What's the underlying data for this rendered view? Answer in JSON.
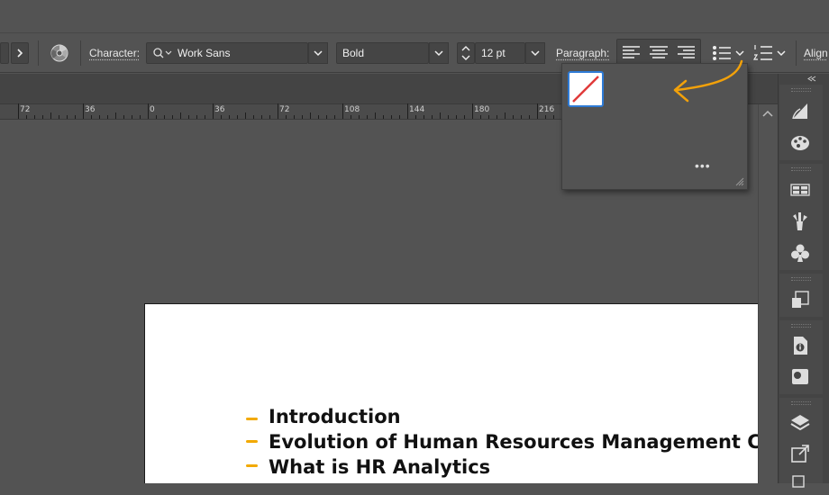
{
  "control_bar": {
    "character_label": "Character:",
    "font_family": "Work Sans",
    "font_style": "Bold",
    "font_size": "12 pt",
    "paragraph_label": "Paragraph:",
    "align_label": "Align"
  },
  "ruler": {
    "labels": [
      "72",
      "36",
      "0",
      "36",
      "72",
      "108",
      "144",
      "180",
      "216"
    ]
  },
  "bullets_popup": {
    "more_label": "•••"
  },
  "document": {
    "items": [
      "Introduction",
      "Evolution of Human Resources Management Cr",
      "What is HR Analytics"
    ],
    "bullet_color": "#f2a900"
  },
  "colors": {
    "ui_background": "#535353",
    "accent_arrow": "#f2a10a",
    "selection_blue": "#2e7bd6",
    "none_swatch_slash": "#e03a3a"
  },
  "right_panel": {
    "icons": [
      "gradient-icon",
      "color-guide-icon",
      "swatches-libraries-icon",
      "brushes-icon",
      "symbols-icon",
      "transform-icon",
      "document-info-icon",
      "image-trace-icon",
      "layers-icon",
      "export-icon"
    ]
  }
}
